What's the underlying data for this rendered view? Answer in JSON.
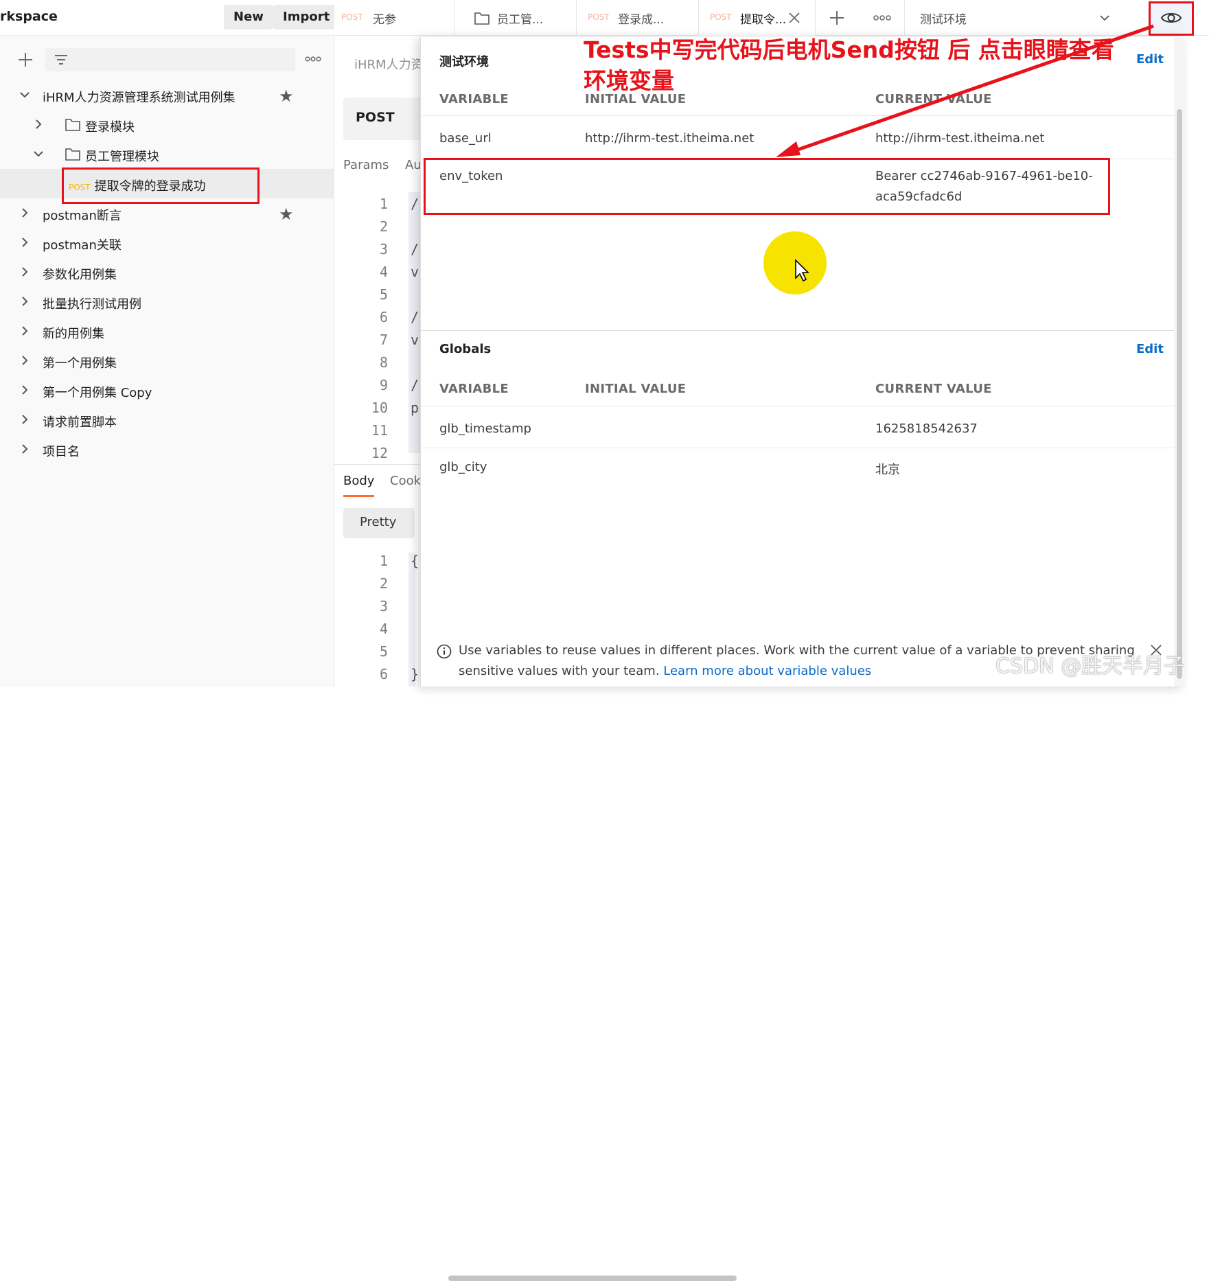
{
  "sidebar": {
    "workspace_title": "rkspace",
    "new_label": "New",
    "import_label": "Import",
    "items": [
      {
        "label": "iHRM人力资源管理系统测试用例集",
        "starred": true
      },
      {
        "label": "登录模块"
      },
      {
        "label": "员工管理模块"
      },
      {
        "method": "POST",
        "label": "提取令牌的登录成功"
      },
      {
        "label": "postman断言",
        "starred": true
      },
      {
        "label": "postman关联"
      },
      {
        "label": "参数化用例集"
      },
      {
        "label": "批量执行测试用例"
      },
      {
        "label": "新的用例集"
      },
      {
        "label": "第一个用例集"
      },
      {
        "label": "第一个用例集 Copy"
      },
      {
        "label": "请求前置脚本"
      },
      {
        "label": "项目名"
      }
    ]
  },
  "tabs": [
    {
      "method": "POST",
      "title": "无参"
    },
    {
      "method": "",
      "title": "员工管..."
    },
    {
      "method": "POST",
      "title": "登录成..."
    },
    {
      "method": "POST",
      "title": "提取令..."
    }
  ],
  "environment_selector": {
    "selected": "测试环境"
  },
  "request": {
    "name": "iHRM人力资",
    "method": "POST",
    "subtabs": [
      "Params",
      "Au"
    ],
    "line_numbers": [
      "1",
      "2",
      "3",
      "4",
      "5",
      "6",
      "7",
      "8",
      "9",
      "10",
      "11",
      "12"
    ],
    "code_fragments": [
      "/",
      "",
      "/",
      "v",
      "",
      "/",
      "v",
      "",
      "/",
      "p"
    ],
    "response_tabs": [
      "Body",
      "Cook"
    ],
    "pretty_label": "Pretty",
    "response_line_numbers": [
      "1",
      "2",
      "3",
      "4",
      "5",
      "6"
    ],
    "response_code_fragments": [
      "{",
      "",
      "",
      "",
      "",
      "}"
    ]
  },
  "env_popover": {
    "environment": {
      "title": "测试环境",
      "edit_label": "Edit",
      "columns": [
        "VARIABLE",
        "INITIAL VALUE",
        "CURRENT VALUE"
      ],
      "rows": [
        {
          "variable": "base_url",
          "initial": "http://ihrm-test.itheima.net",
          "current": "http://ihrm-test.itheima.net"
        },
        {
          "variable": "env_token",
          "initial": "",
          "current": "Bearer cc2746ab-9167-4961-be10-",
          "current_line2": "aca59cfadc6d"
        }
      ]
    },
    "globals": {
      "title": "Globals",
      "edit_label": "Edit",
      "columns": [
        "VARIABLE",
        "INITIAL VALUE",
        "CURRENT VALUE"
      ],
      "rows": [
        {
          "variable": "glb_timestamp",
          "initial": "",
          "current": "1625818542637"
        },
        {
          "variable": "glb_city",
          "initial": "",
          "current": "北京"
        }
      ]
    },
    "info": {
      "text": "Use variables to reuse values in different places. Work with the current value of a variable to prevent sharing sensitive values with your team. ",
      "link": "Learn more about variable values"
    }
  },
  "annotation": {
    "text": "Tests中写完代码后电机Send按钮  后 点击眼睛查看\n环境变量"
  },
  "watermark": "CSDN @胜天半月子",
  "colors": {
    "annotation_red": "#e8121a",
    "link_blue": "#0b6bcb",
    "post_method": "#f8b700",
    "highlight_yellow": "#f7e300"
  }
}
